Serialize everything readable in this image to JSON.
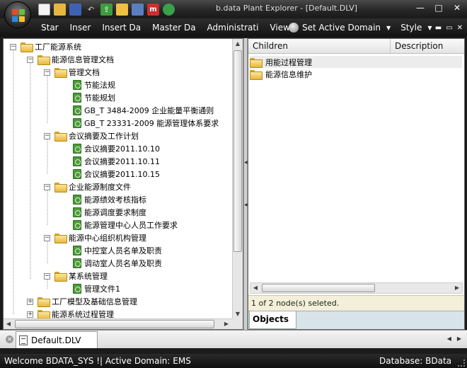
{
  "window": {
    "title": "b.data Plant Explorer - [Default.DLV]",
    "controls": {
      "minimize": "—",
      "maximize": "□",
      "close": "✕"
    }
  },
  "quick_access": [
    "new-file-icon",
    "open-folder-icon",
    "save-icon",
    "undo-icon",
    "export-icon",
    "folder-icon",
    "connect-icon",
    "m-icon",
    "monitor-icon"
  ],
  "menu": {
    "items": [
      "Star",
      "Inser",
      "Insert Da",
      "Master Da",
      "Administrati",
      "View"
    ],
    "active_domain": "Set Active Domain",
    "style": "Style",
    "mdi_controls": {
      "restore": "▭",
      "minimize": "▬",
      "maximize": "▢",
      "close": "✕"
    }
  },
  "tree": {
    "nodes": [
      {
        "label": "工厂能源系统",
        "type": "folder",
        "expander": "−"
      },
      {
        "label": "能源信息管理文档",
        "type": "folder",
        "expander": "−"
      },
      {
        "label": "管理文档",
        "type": "folder",
        "expander": "−"
      },
      {
        "label": "节能法规",
        "type": "doc",
        "expander": ""
      },
      {
        "label": "节能规划",
        "type": "doc",
        "expander": ""
      },
      {
        "label": "GB_T 3484-2009 企业能量平衡通则",
        "type": "doc",
        "expander": ""
      },
      {
        "label": "GB_T 23331-2009 能源管理体系要求",
        "type": "doc",
        "expander": ""
      },
      {
        "label": "会议摘要及工作计划",
        "type": "folder",
        "expander": "−"
      },
      {
        "label": "会议摘要2011.10.10",
        "type": "doc",
        "expander": ""
      },
      {
        "label": "会议摘要2011.10.11",
        "type": "doc",
        "expander": ""
      },
      {
        "label": "会议摘要2011.10.15",
        "type": "doc",
        "expander": ""
      },
      {
        "label": "企业能源制度文件",
        "type": "folder",
        "expander": "−"
      },
      {
        "label": "能源绩效考核指标",
        "type": "doc",
        "expander": ""
      },
      {
        "label": "能源调度要求制度",
        "type": "doc",
        "expander": ""
      },
      {
        "label": "能源管理中心人员工作要求",
        "type": "doc",
        "expander": ""
      },
      {
        "label": "能源中心组织机构管理",
        "type": "folder",
        "expander": "−"
      },
      {
        "label": "中控室人员名单及职责",
        "type": "doc",
        "expander": ""
      },
      {
        "label": "调动室人员名单及职责",
        "type": "doc",
        "expander": ""
      },
      {
        "label": "某系统管理",
        "type": "folder",
        "expander": "−"
      },
      {
        "label": "管理文件1",
        "type": "doc",
        "expander": ""
      },
      {
        "label": "工厂模型及基础信息管理",
        "type": "folder",
        "expander": "+"
      },
      {
        "label": "能源系统过程管理",
        "type": "folder",
        "expander": "+"
      }
    ]
  },
  "children_panel": {
    "columns": [
      "Children",
      "Description"
    ],
    "rows": [
      {
        "label": "用能过程管理",
        "selected": true
      },
      {
        "label": "能源信息维护",
        "selected": false
      }
    ],
    "status": "1 of 2 node(s) seleted.",
    "tab": "Objects"
  },
  "document_tab": {
    "label": "Default.DLV"
  },
  "statusbar": {
    "left": "Welcome  BDATA_SYS  !|  Active Domain:  EMS",
    "right": "Database:  BData"
  }
}
